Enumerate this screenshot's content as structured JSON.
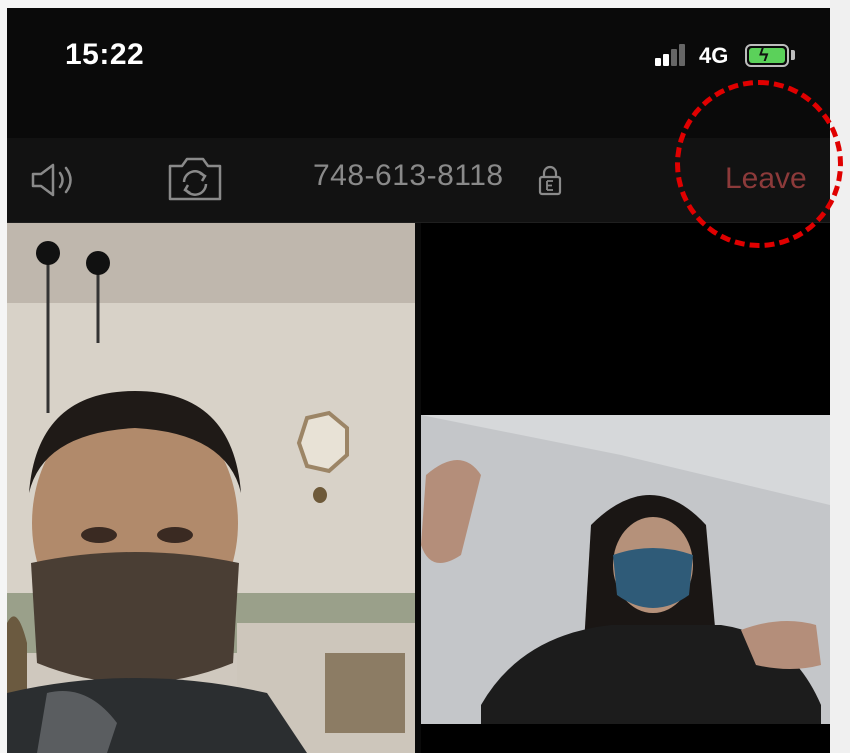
{
  "status_bar": {
    "time": "15:22",
    "network": "4G",
    "battery": "charging"
  },
  "toolbar": {
    "speaker_icon": "speaker-icon",
    "camera_icon": "camera-switch-icon",
    "meeting_id": "748-613-8118",
    "lock_icon": "encrypted-lock-icon",
    "leave_label": "Leave"
  },
  "colors": {
    "leave_text": "#8c3a3a",
    "highlight_circle": "#e00000",
    "meeting_id_text": "#8a8a8a"
  },
  "video_tiles": [
    {
      "participant": "man-with-brown-mask",
      "position": "left"
    },
    {
      "participant": "woman-with-blue-mask",
      "position": "right"
    }
  ]
}
